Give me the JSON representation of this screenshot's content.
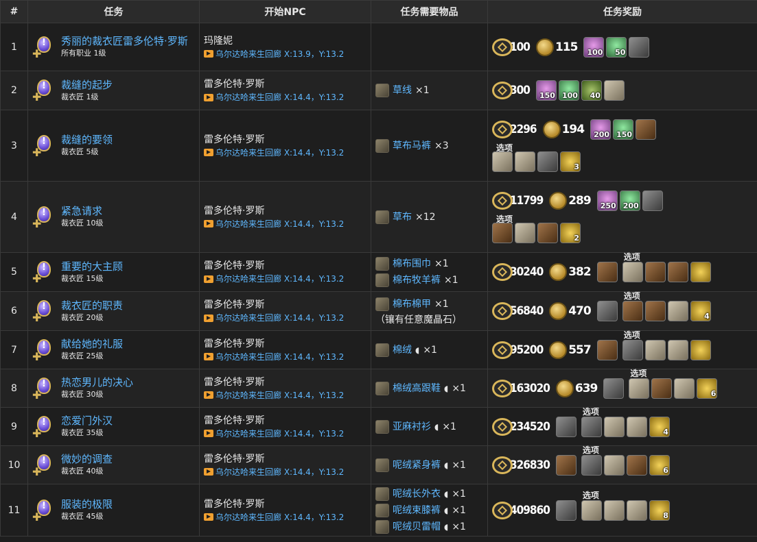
{
  "headers": {
    "num": "#",
    "quest": "任务",
    "npc": "开始NPC",
    "items": "任务需要物品",
    "rewards": "任务奖励"
  },
  "option_label": "选项",
  "rows": [
    {
      "num": "1",
      "name": "秀丽的裁衣匠雷多伦特·罗斯",
      "level": "所有职业 1级",
      "npc": "玛隆妮",
      "loc": "乌尔达哈来生回廊 X:13.9，Y:13.2",
      "items": [],
      "note": "",
      "exp": "100",
      "gil": "115",
      "slots": [
        {
          "c": "crystal-pink",
          "n": "100"
        },
        {
          "c": "crystal-green",
          "n": "50"
        },
        {
          "c": "tool",
          "n": ""
        }
      ],
      "opts": []
    },
    {
      "num": "2",
      "name": "裁缝的起步",
      "level": "裁衣匠 1级",
      "npc": "雷多伦特·罗斯",
      "loc": "乌尔达哈来生回廊 X:14.4，Y:13.2",
      "items": [
        {
          "name": "草线",
          "hq": "",
          "qty": "×1"
        }
      ],
      "note": "",
      "exp": "300",
      "gil": "",
      "slots": [
        {
          "c": "crystal-pink",
          "n": "150"
        },
        {
          "c": "crystal-green",
          "n": "100"
        },
        {
          "c": "herb",
          "n": "40"
        },
        {
          "c": "cloth",
          "n": ""
        }
      ],
      "opts": []
    },
    {
      "num": "3",
      "name": "裁缝的要领",
      "level": "裁衣匠 5级",
      "npc": "雷多伦特·罗斯",
      "loc": "乌尔达哈来生回廊 X:14.4，Y:13.2",
      "items": [
        {
          "name": "草布马裤",
          "hq": "",
          "qty": "×3"
        }
      ],
      "note": "",
      "exp": "2296",
      "gil": "194",
      "slots": [
        {
          "c": "crystal-pink",
          "n": "200"
        },
        {
          "c": "crystal-green",
          "n": "150"
        },
        {
          "c": "brown",
          "n": ""
        }
      ],
      "opts": [
        {
          "c": "cloth",
          "n": ""
        },
        {
          "c": "cloth",
          "n": ""
        },
        {
          "c": "tool",
          "n": ""
        },
        {
          "c": "bag",
          "n": "3"
        }
      ]
    },
    {
      "num": "4",
      "name": "紧急请求",
      "level": "裁衣匠 10级",
      "npc": "雷多伦特·罗斯",
      "loc": "乌尔达哈来生回廊 X:14.4，Y:13.2",
      "items": [
        {
          "name": "草布",
          "hq": "",
          "qty": "×12"
        }
      ],
      "note": "",
      "exp": "11799",
      "gil": "289",
      "slots": [
        {
          "c": "crystal-pink",
          "n": "250"
        },
        {
          "c": "crystal-green",
          "n": "200"
        },
        {
          "c": "tool",
          "n": ""
        }
      ],
      "opts": [
        {
          "c": "brown",
          "n": ""
        },
        {
          "c": "cloth",
          "n": ""
        },
        {
          "c": "brown",
          "n": ""
        },
        {
          "c": "bag",
          "n": "2"
        }
      ]
    },
    {
      "num": "5",
      "name": "重要的大主顾",
      "level": "裁衣匠 15级",
      "npc": "雷多伦特·罗斯",
      "loc": "乌尔达哈来生回廊 X:14.4，Y:13.2",
      "items": [
        {
          "name": "棉布围巾",
          "hq": "",
          "qty": "×1"
        },
        {
          "name": "棉布牧羊裤",
          "hq": "",
          "qty": "×1"
        }
      ],
      "note": "",
      "exp": "30240",
      "gil": "382",
      "slots": [
        {
          "c": "brown",
          "n": ""
        }
      ],
      "opts": [
        {
          "c": "cloth",
          "n": ""
        },
        {
          "c": "brown",
          "n": ""
        },
        {
          "c": "brown",
          "n": ""
        },
        {
          "c": "bag",
          "n": ""
        }
      ]
    },
    {
      "num": "6",
      "name": "裁衣匠的职责",
      "level": "裁衣匠 20级",
      "npc": "雷多伦特·罗斯",
      "loc": "乌尔达哈来生回廊 X:14.4，Y:13.2",
      "items": [
        {
          "name": "棉布棉甲",
          "hq": "",
          "qty": "×1"
        }
      ],
      "note": "（镶有任意魔晶石）",
      "exp": "56840",
      "gil": "470",
      "slots": [
        {
          "c": "tool",
          "n": ""
        }
      ],
      "opts": [
        {
          "c": "brown",
          "n": ""
        },
        {
          "c": "brown",
          "n": ""
        },
        {
          "c": "cloth",
          "n": ""
        },
        {
          "c": "bag",
          "n": "4"
        }
      ]
    },
    {
      "num": "7",
      "name": "献给她的礼服",
      "level": "裁衣匠 25级",
      "npc": "雷多伦特·罗斯",
      "loc": "乌尔达哈来生回廊 X:14.4，Y:13.2",
      "items": [
        {
          "name": "棉绒",
          "hq": "◖",
          "qty": "×1"
        }
      ],
      "note": "",
      "exp": "95200",
      "gil": "557",
      "slots": [
        {
          "c": "brown",
          "n": ""
        }
      ],
      "opts": [
        {
          "c": "tool",
          "n": ""
        },
        {
          "c": "cloth",
          "n": ""
        },
        {
          "c": "cloth",
          "n": ""
        },
        {
          "c": "bag",
          "n": ""
        }
      ]
    },
    {
      "num": "8",
      "name": "热恋男儿的决心",
      "level": "裁衣匠 30级",
      "npc": "雷多伦特·罗斯",
      "loc": "乌尔达哈来生回廊 X:14.4，Y:13.2",
      "items": [
        {
          "name": "棉绒高跟鞋",
          "hq": "◖",
          "qty": "×1"
        }
      ],
      "note": "",
      "exp": "163020",
      "gil": "639",
      "slots": [
        {
          "c": "tool",
          "n": ""
        }
      ],
      "opts": [
        {
          "c": "cloth",
          "n": ""
        },
        {
          "c": "brown",
          "n": ""
        },
        {
          "c": "cloth",
          "n": ""
        },
        {
          "c": "bag",
          "n": "6"
        }
      ]
    },
    {
      "num": "9",
      "name": "恋爱门外汉",
      "level": "裁衣匠 35级",
      "npc": "雷多伦特·罗斯",
      "loc": "乌尔达哈来生回廊 X:14.4，Y:13.2",
      "items": [
        {
          "name": "亚麻衬衫",
          "hq": "◖",
          "qty": "×1"
        }
      ],
      "note": "",
      "exp": "234520",
      "gil": "",
      "slots": [
        {
          "c": "tool",
          "n": ""
        }
      ],
      "opts": [
        {
          "c": "tool",
          "n": ""
        },
        {
          "c": "cloth",
          "n": ""
        },
        {
          "c": "cloth",
          "n": ""
        },
        {
          "c": "bag",
          "n": "4"
        }
      ]
    },
    {
      "num": "10",
      "name": "微妙的调查",
      "level": "裁衣匠 40级",
      "npc": "雷多伦特·罗斯",
      "loc": "乌尔达哈来生回廊 X:14.4，Y:13.2",
      "items": [
        {
          "name": "呢绒紧身裤",
          "hq": "◖",
          "qty": "×1"
        }
      ],
      "note": "",
      "exp": "326830",
      "gil": "",
      "slots": [
        {
          "c": "brown",
          "n": ""
        }
      ],
      "opts": [
        {
          "c": "tool",
          "n": ""
        },
        {
          "c": "cloth",
          "n": ""
        },
        {
          "c": "brown",
          "n": ""
        },
        {
          "c": "bag",
          "n": "6"
        }
      ]
    },
    {
      "num": "11",
      "name": "服装的极限",
      "level": "裁衣匠 45级",
      "npc": "雷多伦特·罗斯",
      "loc": "乌尔达哈来生回廊 X:14.4，Y:13.2",
      "items": [
        {
          "name": "呢绒长外衣",
          "hq": "◖",
          "qty": "×1"
        },
        {
          "name": "呢绒束膝裤",
          "hq": "◖",
          "qty": "×1"
        },
        {
          "name": "呢绒贝雷帽",
          "hq": "◖",
          "qty": "×1"
        }
      ],
      "note": "",
      "exp": "409860",
      "gil": "",
      "slots": [
        {
          "c": "tool",
          "n": ""
        }
      ],
      "opts": [
        {
          "c": "cloth",
          "n": ""
        },
        {
          "c": "cloth",
          "n": ""
        },
        {
          "c": "cloth",
          "n": ""
        },
        {
          "c": "bag",
          "n": "8"
        }
      ]
    }
  ]
}
